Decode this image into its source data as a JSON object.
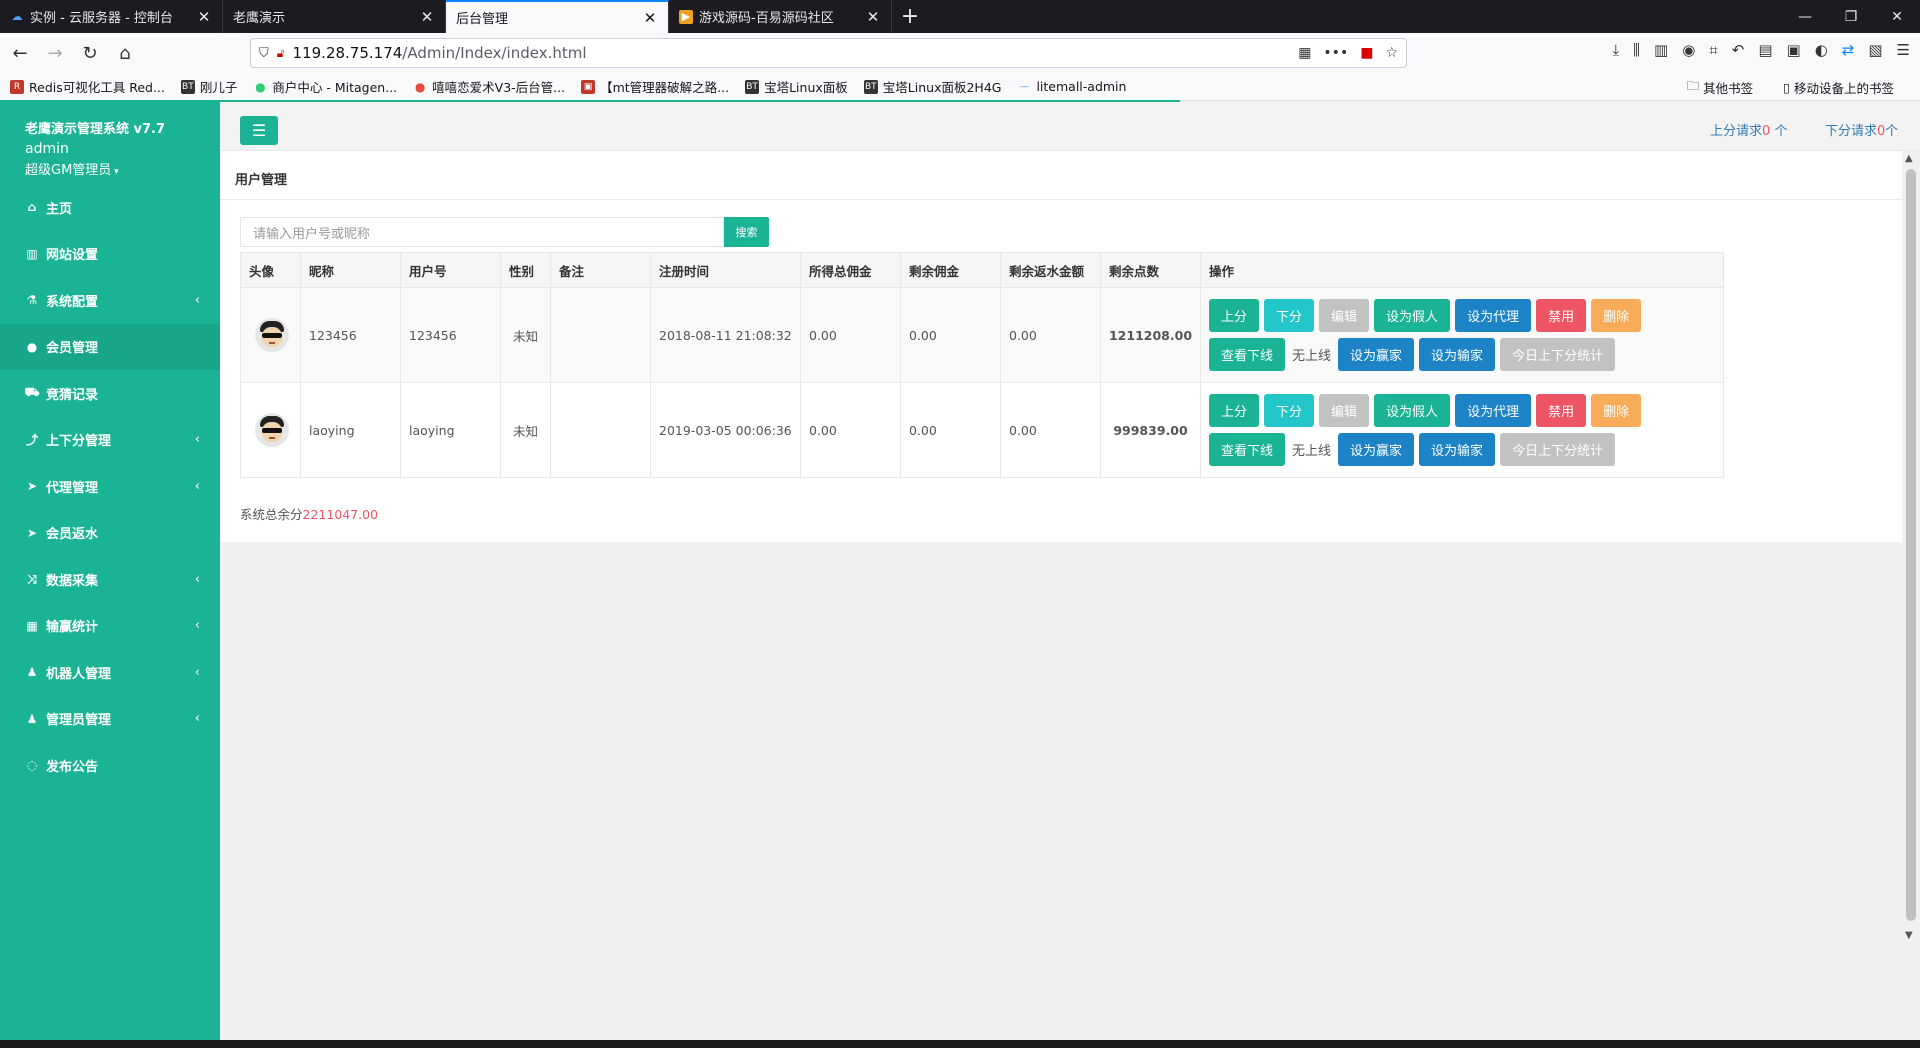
{
  "browser": {
    "tabs": [
      {
        "label": "实例 - 云服务器 - 控制台",
        "icon": "cloud-icon"
      },
      {
        "label": "老鹰演示",
        "icon": "none"
      },
      {
        "label": "后台管理",
        "icon": "none",
        "active": true
      },
      {
        "label": "游戏源码-百易源码社区",
        "icon": "page-icon"
      }
    ],
    "url_host": "119.28.75.174",
    "url_path": "/Admin/Index/index.html",
    "bookmarks": [
      {
        "label": "Redis可视化工具 Red...",
        "badge": "R"
      },
      {
        "label": "刚儿子",
        "badge": "BT"
      },
      {
        "label": "商户中心 - Mitagen...",
        "badge": "●"
      },
      {
        "label": "嘻嘻恋爱术V3-后台管...",
        "badge": "●"
      },
      {
        "label": "【mt管理器破解之路...",
        "badge": "▣"
      },
      {
        "label": "宝塔Linux面板",
        "badge": "BT"
      },
      {
        "label": "宝塔Linux面板2H4G",
        "badge": "BT"
      },
      {
        "label": "litemall-admin",
        "badge": "—"
      }
    ],
    "bookmarks_right": [
      "其他书签",
      "移动设备上的书签"
    ]
  },
  "sidebar": {
    "brand": "老鹰演示管理系统 v7.7",
    "username": "admin",
    "role": "超级GM管理员",
    "items": [
      {
        "label": "主页",
        "icon": "home-icon",
        "chev": false
      },
      {
        "label": "网站设置",
        "icon": "columns-icon",
        "chev": false
      },
      {
        "label": "系统配置",
        "icon": "flask-icon",
        "chev": true
      },
      {
        "label": "会员管理",
        "icon": "user-icon",
        "chev": false,
        "active": true
      },
      {
        "label": "竞猜记录",
        "icon": "car-icon",
        "chev": false
      },
      {
        "label": "上下分管理",
        "icon": "level-up-icon",
        "chev": true
      },
      {
        "label": "代理管理",
        "icon": "paper-plane-icon",
        "chev": true
      },
      {
        "label": "会员返水",
        "icon": "paper-plane-icon",
        "chev": false
      },
      {
        "label": "数据采集",
        "icon": "random-icon",
        "chev": true
      },
      {
        "label": "输赢统计",
        "icon": "bar-chart-icon",
        "chev": true
      },
      {
        "label": "机器人管理",
        "icon": "male-icon",
        "chev": true
      },
      {
        "label": "管理员管理",
        "icon": "male-icon",
        "chev": true
      },
      {
        "label": "发布公告",
        "icon": "comment-icon",
        "chev": false
      }
    ]
  },
  "topbar": {
    "up_label": "上分请求",
    "up_count": "0",
    "down_label": "下分请求",
    "down_count": "0",
    "unit": "个"
  },
  "page": {
    "title": "用户管理",
    "search_placeholder": "请输入用户号或昵称",
    "search_button": "搜索",
    "columns": [
      "头像",
      "昵称",
      "用户号",
      "性别",
      "备注",
      "注册时间",
      "所得总佣金",
      "剩余佣金",
      "剩余返水金额",
      "剩余点数",
      "操作"
    ],
    "rows": [
      {
        "nickname": "123456",
        "userid": "123456",
        "sex": "未知",
        "note": "",
        "regtime": "2018-08-11 21:08:32",
        "total_comm": "0.00",
        "remain_comm": "0.00",
        "rebate": "0.00",
        "points": "1211208.00"
      },
      {
        "nickname": "laoying",
        "userid": "laoying",
        "sex": "未知",
        "note": "",
        "regtime": "2019-03-05 00:06:36",
        "total_comm": "0.00",
        "remain_comm": "0.00",
        "rebate": "0.00",
        "points": "999839.00"
      }
    ],
    "actions": {
      "up": "上分",
      "down": "下分",
      "edit": "编辑",
      "set_fake": "设为假人",
      "set_agent": "设为代理",
      "disable": "禁用",
      "delete": "删除",
      "view_down": "查看下线",
      "no_upline": "无上线",
      "set_winner": "设为赢家",
      "set_loser": "设为输家",
      "today_stats": "今日上下分统计"
    },
    "total_label": "系统总余分",
    "total_value": "2211047.00"
  },
  "colors": {
    "primary": "#1ab394",
    "info": "#23c6c8",
    "blue": "#1c84c6",
    "danger": "#ed5565",
    "warning": "#f8ac59",
    "disabled": "#c2c2c2"
  }
}
